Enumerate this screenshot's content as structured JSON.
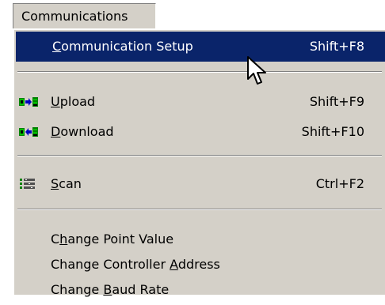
{
  "menubar": {
    "title": "Communications"
  },
  "menu": {
    "items": [
      {
        "pre": "",
        "mn": "C",
        "post": "ommunication Setup",
        "shortcut": "Shift+F8",
        "icon": "",
        "highlighted": true
      },
      {
        "pre": "",
        "mn": "U",
        "post": "pload",
        "shortcut": "Shift+F9",
        "icon": "upload-icon"
      },
      {
        "pre": "",
        "mn": "D",
        "post": "ownload",
        "shortcut": "Shift+F10",
        "icon": "download-icon"
      },
      {
        "pre": "",
        "mn": "S",
        "post": "can",
        "shortcut": "Ctrl+F2",
        "icon": "scan-icon"
      },
      {
        "pre": "C",
        "mn": "h",
        "post": "ange Point Value",
        "shortcut": "",
        "icon": ""
      },
      {
        "pre": "Change Controller ",
        "mn": "A",
        "post": "ddress",
        "shortcut": "",
        "icon": ""
      },
      {
        "pre": "Change ",
        "mn": "B",
        "post": "aud Rate",
        "shortcut": "",
        "icon": ""
      }
    ]
  },
  "colors": {
    "menu_bg": "#d4d0c8",
    "highlight_bg": "#0a246a",
    "highlight_fg": "#ffffff"
  },
  "cursor_icon": "arrow-pointer-icon"
}
